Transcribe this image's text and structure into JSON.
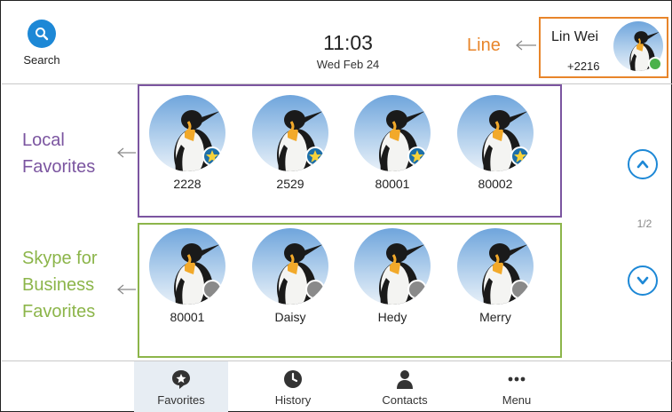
{
  "header": {
    "search_label": "Search",
    "time": "11:03",
    "date": "Wed Feb 24"
  },
  "line": {
    "callout": "Line",
    "name": "Lin Wei",
    "extension": "+2216",
    "status": "online"
  },
  "callouts": {
    "local_line1": "Local",
    "local_line2": "Favorites",
    "skype_line1": "Skype for",
    "skype_line2": "Business",
    "skype_line3": "Favorites"
  },
  "local_favorites": [
    {
      "label": "2228",
      "badge": "star-icon"
    },
    {
      "label": "2529",
      "badge": "star-icon"
    },
    {
      "label": "80001",
      "badge": "star-icon"
    },
    {
      "label": "80002",
      "badge": "star-icon"
    }
  ],
  "skype_favorites": [
    {
      "label": "80001",
      "badge": "offline-status"
    },
    {
      "label": "Daisy",
      "badge": "offline-status"
    },
    {
      "label": "Hedy",
      "badge": "offline-status"
    },
    {
      "label": "Merry",
      "badge": "offline-status"
    }
  ],
  "pagination": {
    "indicator": "1/2"
  },
  "tabs": [
    {
      "label": "Favorites",
      "icon": "favorites-icon",
      "active": true
    },
    {
      "label": "History",
      "icon": "history-clock-icon",
      "active": false
    },
    {
      "label": "Contacts",
      "icon": "contacts-person-icon",
      "active": false
    },
    {
      "label": "Menu",
      "icon": "menu-dots-icon",
      "active": false
    }
  ],
  "colors": {
    "accent_blue": "#1d88d6",
    "line_orange": "#e8852a",
    "local_purple": "#7b55a0",
    "skype_green": "#8cb54a"
  }
}
